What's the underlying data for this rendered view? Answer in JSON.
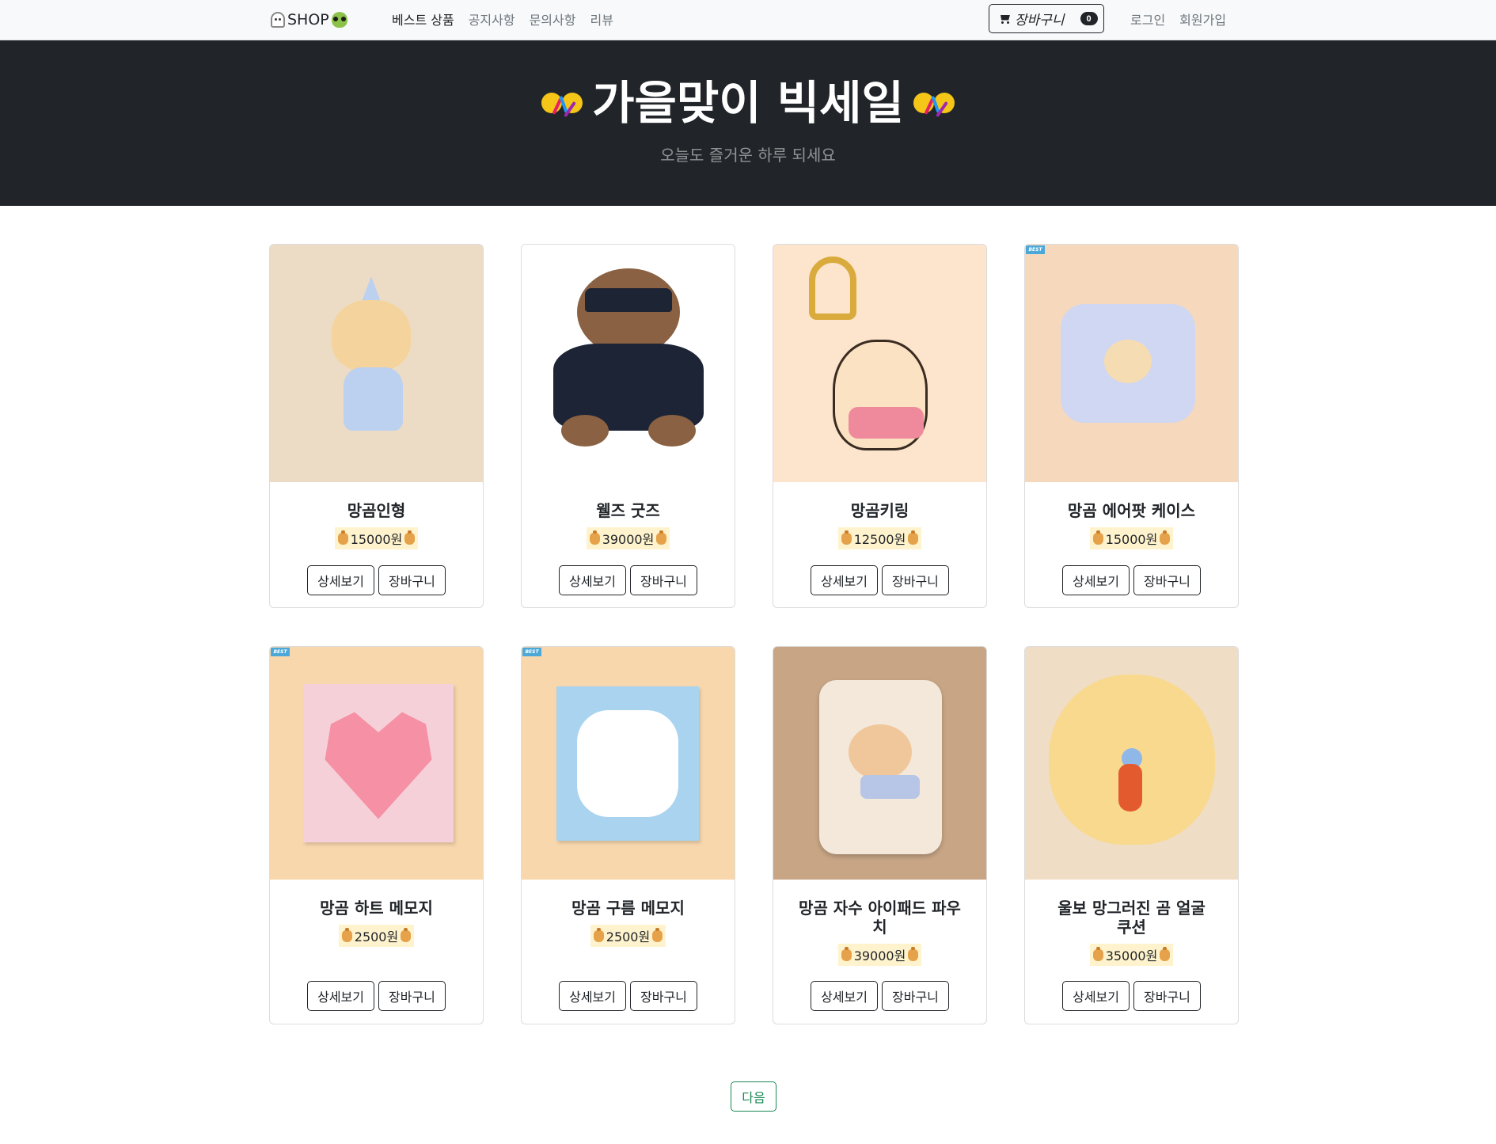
{
  "navbar": {
    "brand": "SHOP",
    "links": [
      {
        "label": "베스트 상품",
        "active": true
      },
      {
        "label": "공지사항",
        "active": false
      },
      {
        "label": "문의사항",
        "active": false
      },
      {
        "label": "리뷰",
        "active": false
      }
    ],
    "cart_label": "장바구니",
    "cart_count": "0",
    "login": "로그인",
    "signup": "회원가입"
  },
  "hero": {
    "title": "가을맞이 빅세일",
    "subtitle": "오늘도 즐거운 하루 되세요"
  },
  "products": [
    {
      "name": "망곰인형",
      "price": "15000원",
      "best": false,
      "bg": "#ecdcc6"
    },
    {
      "name": "웰즈 굿즈",
      "price": "39000원",
      "best": false,
      "bg": "#ffffff"
    },
    {
      "name": "망곰키링",
      "price": "12500원",
      "best": false,
      "bg": "#fde4cc"
    },
    {
      "name": "망곰 에어팟 케이스",
      "price": "15000원",
      "best": true,
      "best_label": "BEST",
      "bg": "#f6d9bd"
    },
    {
      "name": "망곰 하트 메모지",
      "price": "2500원",
      "best": true,
      "best_label": "BEST",
      "bg": "#f8d7ad"
    },
    {
      "name": "망곰 구름 메모지",
      "price": "2500원",
      "best": true,
      "best_label": "BEST",
      "bg": "#f8d7ad"
    },
    {
      "name": "망곰 자수 아이패드 파우치",
      "price": "39000원",
      "best": false,
      "bg": "#c7a585"
    },
    {
      "name": "울보 망그러진 곰 얼굴 쿠션",
      "price": "35000원",
      "best": false,
      "bg": "#efddc6"
    }
  ],
  "buttons": {
    "detail": "상세보기",
    "cart": "장바구니",
    "next": "다음"
  },
  "colors": {
    "hero_bg": "#212529",
    "price_bg": "#fff3cd",
    "next_green": "#198754",
    "best_blue": "#4ba8d8"
  },
  "icons": [
    "ghost-icon",
    "alien-icon",
    "cart-icon",
    "party-face-icon",
    "money-bag-icon"
  ]
}
